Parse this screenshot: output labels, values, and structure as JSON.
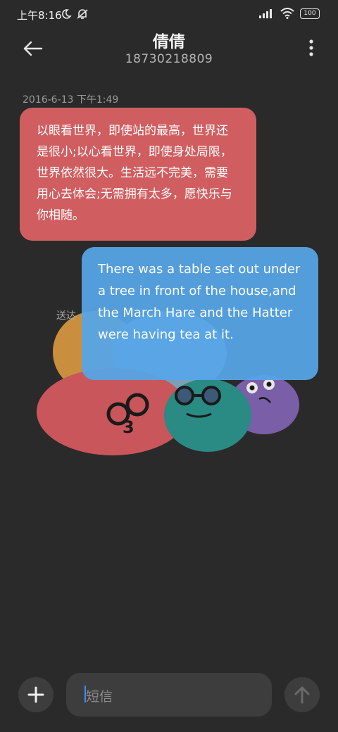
{
  "status_bar": {
    "time": "上午8:16",
    "icons": [
      "moon-icon",
      "muted-bell-icon",
      "signal-icon",
      "wifi-icon"
    ],
    "battery": "100"
  },
  "header": {
    "back_icon": "arrow-left-icon",
    "contact_name": "倩倩",
    "phone": "18730218809",
    "more_icon": "more-vertical-icon"
  },
  "thread": {
    "timestamp": "2016-6-13 下午1:49",
    "incoming": {
      "text": "以眼看世界，即使站的最高，世界还是很小;以心看世界，即使身处局限，世界依然很大。生活远不完美，需要用心去体会;无需拥有太多，愿快乐与你相随。",
      "color": "#d05e60"
    },
    "outgoing": {
      "text": "There was a table set out under a tree in front of the house,and the March Hare and the Hatter were having tea at it.",
      "color": "#56a6e8"
    },
    "delivered_label": "送达"
  },
  "composer": {
    "add_icon": "plus-icon",
    "placeholder": "短信",
    "send_icon": "arrow-up-icon"
  }
}
